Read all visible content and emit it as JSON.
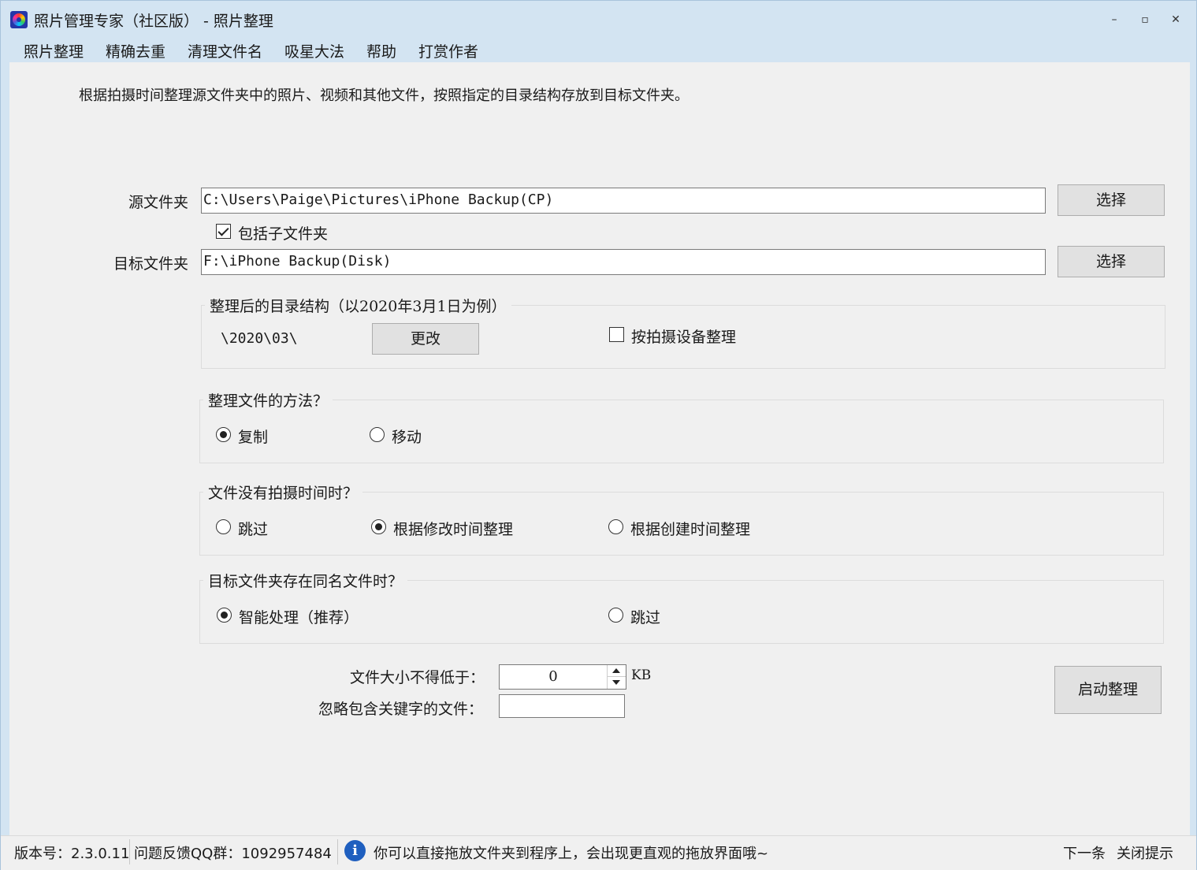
{
  "window": {
    "title": "照片管理专家（社区版） - 照片整理",
    "minimize": "–",
    "maximize": "▫",
    "close": "✕"
  },
  "menu": [
    "照片整理",
    "精确去重",
    "清理文件名",
    "吸星大法",
    "帮助",
    "打赏作者"
  ],
  "description": "根据拍摄时间整理源文件夹中的照片、视频和其他文件，按照指定的目录结构存放到目标文件夹。",
  "source": {
    "label": "源文件夹",
    "value": "C:\\Users\\Paige\\Pictures\\iPhone Backup(CP)",
    "choose_label": "选择",
    "include_subfolders": {
      "label": "包括子文件夹",
      "checked": true
    }
  },
  "target": {
    "label": "目标文件夹",
    "value": "F:\\iPhone Backup(Disk)",
    "choose_label": "选择"
  },
  "structure": {
    "title": "整理后的目录结构（以2020年3月1日为例）",
    "example": "\\2020\\03\\",
    "change_label": "更改",
    "by_device": {
      "label": "按拍摄设备整理",
      "checked": false
    }
  },
  "method": {
    "title": "整理文件的方法？",
    "options": [
      {
        "label": "复制",
        "checked": true
      },
      {
        "label": "移动",
        "checked": false
      }
    ]
  },
  "no_time": {
    "title": "文件没有拍摄时间时？",
    "options": [
      {
        "label": "跳过",
        "checked": false
      },
      {
        "label": "根据修改时间整理",
        "checked": true
      },
      {
        "label": "根据创建时间整理",
        "checked": false
      }
    ]
  },
  "duplicate": {
    "title": "目标文件夹存在同名文件时？",
    "options": [
      {
        "label": "智能处理（推荐）",
        "checked": true
      },
      {
        "label": "跳过",
        "checked": false
      }
    ]
  },
  "min_size": {
    "label": "文件大小不得低于：",
    "value": "0",
    "unit": "KB"
  },
  "ignore_keyword": {
    "label": "忽略包含关键字的文件：",
    "value": ""
  },
  "start_label": "启动整理",
  "status": {
    "version": "版本号：2.3.0.11",
    "qq": "问题反馈QQ群：1092957484",
    "info_icon": "i",
    "tip": "你可以直接拖放文件夹到程序上，会出现更直观的拖放界面哦~",
    "next": "下一条",
    "close_tip": "关闭提示"
  }
}
